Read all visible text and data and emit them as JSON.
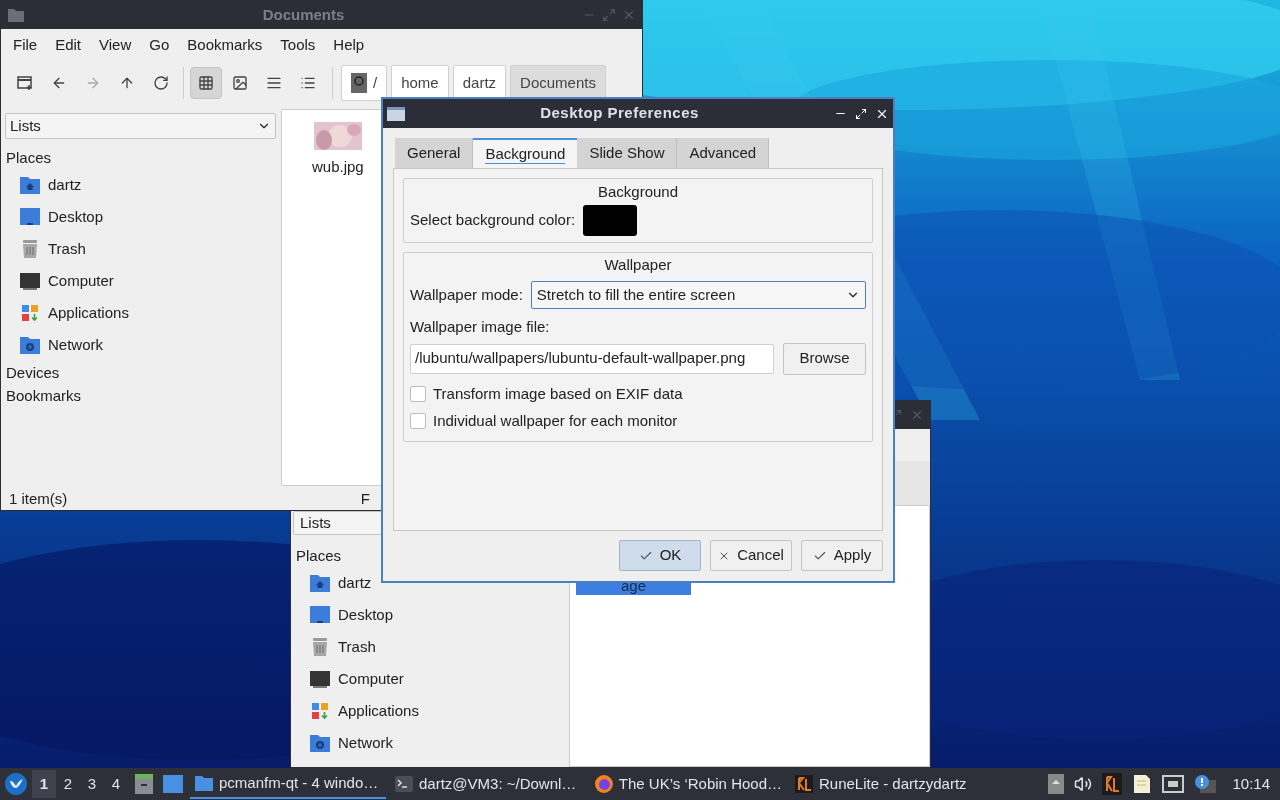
{
  "file_manager": {
    "title": "Documents",
    "menu": [
      "File",
      "Edit",
      "View",
      "Go",
      "Bookmarks",
      "Tools",
      "Help"
    ],
    "view_buttons": [
      {
        "kind": "icons",
        "selected": true
      },
      {
        "kind": "thumbnails",
        "selected": false
      },
      {
        "kind": "compact",
        "selected": false
      },
      {
        "kind": "details",
        "selected": false
      }
    ],
    "path": [
      {
        "label": "/",
        "selected": false
      },
      {
        "label": "home",
        "selected": false
      },
      {
        "label": "dartz",
        "selected": false
      },
      {
        "label": "Documents",
        "selected": true
      }
    ],
    "sidebar": {
      "dropdown": "Lists",
      "places_title": "Places",
      "places": [
        {
          "label": "dartz",
          "kind": "home"
        },
        {
          "label": "Desktop",
          "kind": "desktop"
        },
        {
          "label": "Trash",
          "kind": "trash"
        },
        {
          "label": "Computer",
          "kind": "computer"
        },
        {
          "label": "Applications",
          "kind": "applications"
        },
        {
          "label": "Network",
          "kind": "network"
        }
      ],
      "sections": [
        "Devices",
        "Bookmarks"
      ]
    },
    "files": [
      {
        "name": "wub.jpg"
      }
    ],
    "status": "1 item(s)",
    "status_2": "F"
  },
  "second_window": {
    "dropdown": "Lists",
    "places_title": "Places",
    "places": [
      {
        "label": "dartz",
        "kind": "home"
      },
      {
        "label": "Desktop",
        "kind": "desktop"
      },
      {
        "label": "Trash",
        "kind": "trash"
      },
      {
        "label": "Computer",
        "kind": "computer"
      },
      {
        "label": "Applications",
        "kind": "applications"
      },
      {
        "label": "Network",
        "kind": "network"
      }
    ],
    "files": [
      {
        "name": "age",
        "selected": true
      }
    ]
  },
  "dialog": {
    "title": "Desktop Preferences",
    "tabs": [
      {
        "label": "General",
        "selected": false
      },
      {
        "label": "Background",
        "selected": true
      },
      {
        "label": "Slide Show",
        "selected": false
      },
      {
        "label": "Advanced",
        "selected": false
      }
    ],
    "background_group": {
      "title": "Background",
      "color_label": "Select background color:",
      "color": "#000000"
    },
    "wallpaper_group": {
      "title": "Wallpaper",
      "mode_label": "Wallpaper mode:",
      "mode": "Stretch to fill the entire screen",
      "file_label": "Wallpaper image file:",
      "file": "/lubuntu/wallpapers/lubuntu-default-wallpaper.png",
      "browse": "Browse",
      "options": [
        {
          "label": "Transform image based on EXIF data",
          "checked": false
        },
        {
          "label": "Individual wallpaper for each monitor",
          "checked": false
        }
      ]
    },
    "buttons": [
      {
        "label": "OK",
        "kind": "check",
        "selected": true
      },
      {
        "label": "Cancel",
        "kind": "cross",
        "selected": false
      },
      {
        "label": "Apply",
        "kind": "check",
        "selected": false
      }
    ]
  },
  "taskbar": {
    "workspaces": [
      {
        "label": "1",
        "selected": true
      },
      {
        "label": "2",
        "selected": false
      },
      {
        "label": "3",
        "selected": false
      },
      {
        "label": "4",
        "selected": false
      }
    ],
    "tasks": [
      {
        "label": "pcmanfm-qt - 4 windo…",
        "kind": "folder",
        "selected": true
      },
      {
        "label": "dartz@VM3: ~/Downl…",
        "kind": "terminal",
        "selected": false
      },
      {
        "label": "The UK’s ‘Robin Hood…",
        "kind": "browser",
        "selected": false
      },
      {
        "label": "RuneLite - dartzydartz",
        "kind": "game",
        "selected": false
      }
    ],
    "clock": "10:14"
  }
}
